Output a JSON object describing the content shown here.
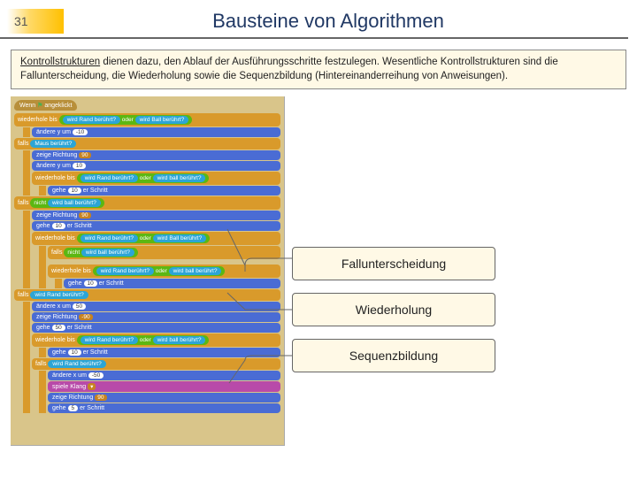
{
  "header": {
    "page_number": "31",
    "title": "Bausteine von Algorithmen"
  },
  "intro": {
    "keyword": "Kontrollstrukturen",
    "rest": " dienen dazu, den Ablauf der Ausführungsschritte festzulegen. Wesentliche Kontrollstrukturen sind die Fallunterscheidung, die Wiederholung sowie die Sequenzbildung (Hintereinanderreihung von Anweisungen)."
  },
  "scratch": {
    "hat_prefix": "Wenn ",
    "hat_suffix": " angeklickt",
    "wiederhole_bis": "wiederhole bis",
    "wird_rand": "wird Rand berührt?",
    "wird_ball": "wird Ball berührt?",
    "oder": "oder",
    "nicht": "nicht",
    "aendere_y": "ändere y um",
    "aendere_x": "ändere x um",
    "falls": "falls",
    "maus": "Maus berührt?",
    "zeige_richtung": "zeige Richtung",
    "r90": "90",
    "r_90": "-90",
    "rand_ber": "wird Rand berührt?",
    "ball_ber": "wird ball berührt?",
    "gehe": "gehe",
    "er_schritt": "er Schritt",
    "ten": "10",
    "neg10": "-10",
    "neg50": "-50",
    "fifty": "50",
    "spiele_klang": "spiele Klang"
  },
  "callouts": {
    "c1": "Fallunterscheidung",
    "c2": "Wiederholung",
    "c3": "Sequenzbildung"
  }
}
